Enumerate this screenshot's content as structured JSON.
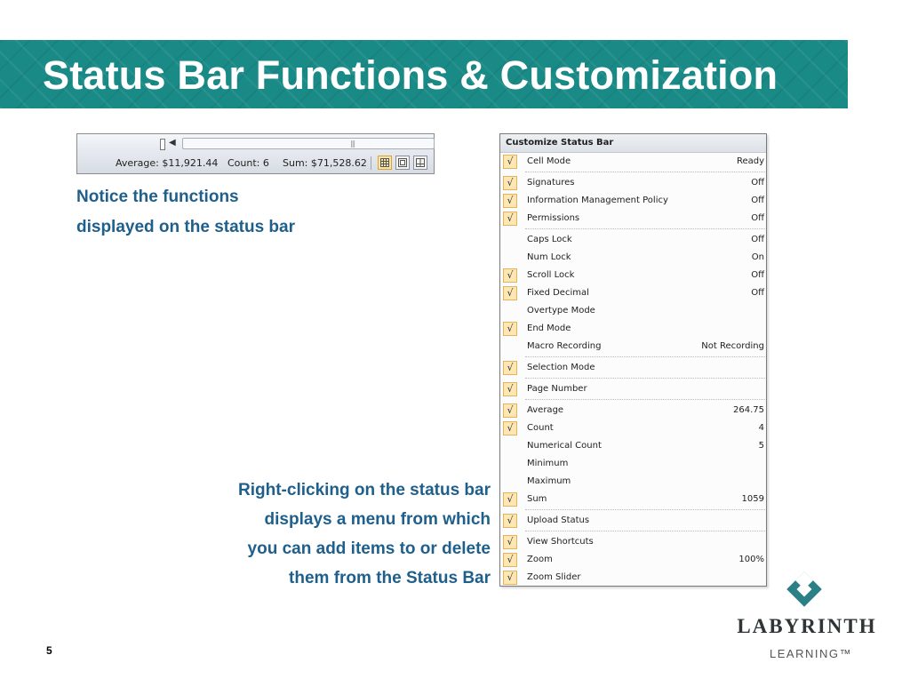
{
  "slide": {
    "title": "Status Bar Functions & Customization",
    "page_number": "5"
  },
  "status_bar": {
    "average": "Average: $11,921.44",
    "count": "Count: 6",
    "sum": "Sum: $71,528.62",
    "views": [
      "normal-view-icon",
      "page-layout-view-icon",
      "page-break-preview-icon"
    ],
    "active_view": "normal-view-icon"
  },
  "notice_text": [
    "Notice the functions",
    "displayed on the status bar"
  ],
  "right_click_text": [
    "Right-clicking on the status bar",
    "displays a menu from which",
    "you can add items to or delete",
    "them from the Status Bar"
  ],
  "menu": {
    "title": "Customize Status Bar",
    "check_glyph": "√",
    "items": [
      {
        "label": "Cell Mode",
        "value": "Ready",
        "checked": true
      },
      {
        "label": "Signatures",
        "value": "Off",
        "checked": true
      },
      {
        "label": "Information Management Policy",
        "value": "Off",
        "checked": true
      },
      {
        "label": "Permissions",
        "value": "Off",
        "checked": true
      },
      {
        "label": "Caps Lock",
        "value": "Off",
        "checked": false
      },
      {
        "label": "Num Lock",
        "value": "On",
        "checked": false
      },
      {
        "label": "Scroll Lock",
        "value": "Off",
        "checked": true
      },
      {
        "label": "Fixed Decimal",
        "value": "Off",
        "checked": true
      },
      {
        "label": "Overtype Mode",
        "value": "",
        "checked": false
      },
      {
        "label": "End Mode",
        "value": "",
        "checked": true
      },
      {
        "label": "Macro Recording",
        "value": "Not Recording",
        "checked": false
      },
      {
        "label": "Selection Mode",
        "value": "",
        "checked": true
      },
      {
        "label": "Page Number",
        "value": "",
        "checked": true
      },
      {
        "label": "Average",
        "value": "264.75",
        "checked": true
      },
      {
        "label": "Count",
        "value": "4",
        "checked": true
      },
      {
        "label": "Numerical Count",
        "value": "5",
        "checked": false
      },
      {
        "label": "Minimum",
        "value": "",
        "checked": false
      },
      {
        "label": "Maximum",
        "value": "",
        "checked": false
      },
      {
        "label": "Sum",
        "value": "1059",
        "checked": true
      },
      {
        "label": "Upload Status",
        "value": "",
        "checked": true
      },
      {
        "label": "View Shortcuts",
        "value": "",
        "checked": true
      },
      {
        "label": "Zoom",
        "value": "100%",
        "checked": true
      },
      {
        "label": "Zoom Slider",
        "value": "",
        "checked": true
      }
    ]
  },
  "logo": {
    "name": "LABYRINTH",
    "sub": "LEARNING™",
    "colors": {
      "mark": "#2b7f86"
    }
  },
  "colors": {
    "title_band": "#1a8a86",
    "body_text": "#1f5f8b",
    "check_fill": "#fde7b4"
  }
}
